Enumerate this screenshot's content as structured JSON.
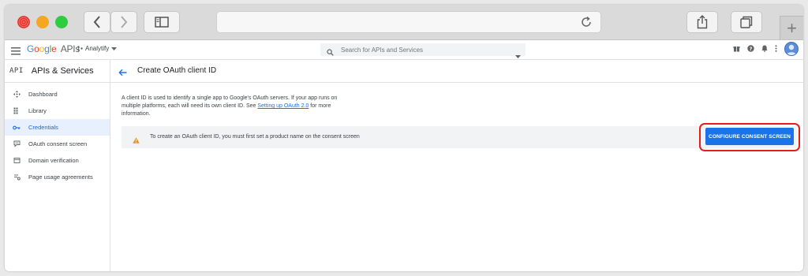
{
  "header": {
    "logo_google": "Google",
    "logo_apis": "APIs",
    "project_name": "Analytify",
    "search_placeholder": "Search for APIs and Services"
  },
  "sidebar": {
    "api_label": "API",
    "title": "APIs & Services",
    "items": [
      {
        "label": "Dashboard",
        "icon": "dashboard-icon"
      },
      {
        "label": "Library",
        "icon": "library-icon"
      },
      {
        "label": "Credentials",
        "icon": "key-icon",
        "active": true
      },
      {
        "label": "OAuth consent screen",
        "icon": "consent-icon"
      },
      {
        "label": "Domain verification",
        "icon": "domain-icon"
      },
      {
        "label": "Page usage agreements",
        "icon": "agreements-icon"
      }
    ]
  },
  "main": {
    "title": "Create OAuth client ID",
    "description_before": "A client ID is used to identify a single app to Google's OAuth servers. If your app runs on multiple platforms, each will need its own client ID. See ",
    "description_link": "Setting up OAuth 2.0",
    "description_after": " for more information.",
    "banner_text": "To create an OAuth client ID, you must first set a product name on the consent screen",
    "configure_button": "CONFIGURE CONSENT SCREEN"
  },
  "colors": {
    "accent": "#1a73e8",
    "highlight": "#e0201b",
    "warning": "#f29900",
    "active_bg": "#e8f0fe"
  }
}
